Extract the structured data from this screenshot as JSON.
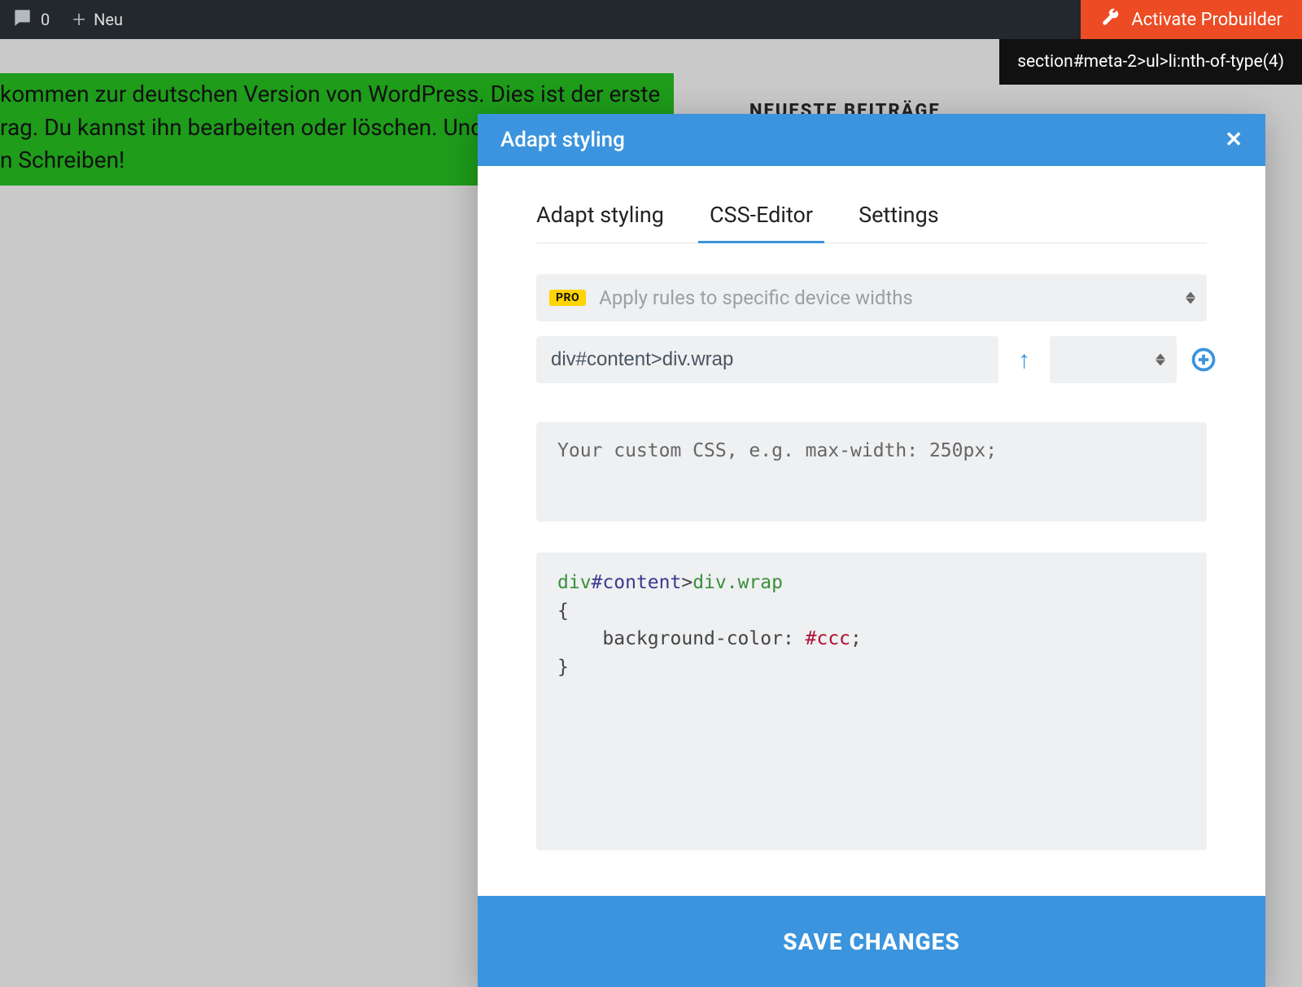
{
  "adminbar": {
    "comment_count": "0",
    "new_label": "Neu",
    "activate_label": "Activate Probuilder"
  },
  "selector_tooltip": "section#meta-2>ul>li:nth-of-type(4)",
  "page": {
    "highlight_line1": "kommen zur deutschen Version von WordPress. Dies ist der erste",
    "highlight_line2": "rag. Du kannst ihn bearbeiten oder löschen. Und",
    "highlight_line3": "n Schreiben!",
    "sidebar_heading": "NEUESTE BEITRÄGE"
  },
  "modal": {
    "title": "Adapt styling",
    "tabs": {
      "adapt": "Adapt styling",
      "css": "CSS-Editor",
      "settings": "Settings"
    },
    "pro_badge": "PRO",
    "pro_placeholder": "Apply rules to specific device widths",
    "selector_value": "div#content>div.wrap",
    "css_placeholder": "Your custom CSS, e.g. max-width: 250px;",
    "css_code": {
      "tag1": "div",
      "id": "#content",
      "gt": ">",
      "tag2": "div",
      "cls": ".wrap",
      "open": "{",
      "indent": "    ",
      "prop": "background-color: ",
      "hex": "#ccc",
      "semi": ";",
      "close": "}"
    },
    "save_label": "SAVE CHANGES"
  }
}
